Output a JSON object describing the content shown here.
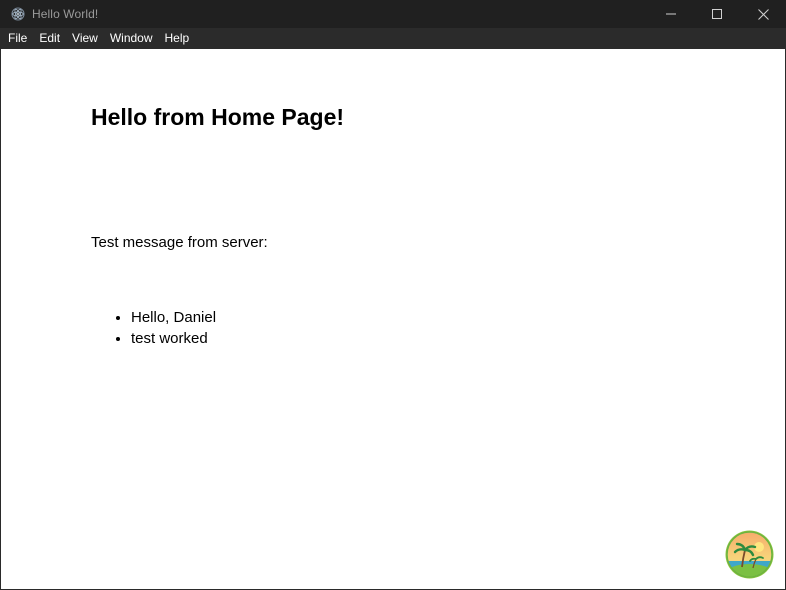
{
  "window": {
    "title": "Hello World!"
  },
  "menu": {
    "items": [
      {
        "label": "File"
      },
      {
        "label": "Edit"
      },
      {
        "label": "View"
      },
      {
        "label": "Window"
      },
      {
        "label": "Help"
      }
    ]
  },
  "main": {
    "title": "Hello from Home Page!",
    "message_label": "Test message from server:",
    "messages": [
      "Hello, Daniel",
      "test worked"
    ]
  },
  "icons": {
    "app": "electron-icon",
    "minimize": "minimize-icon",
    "maximize": "maximize-icon",
    "close": "close-icon",
    "avatar": "palm-island-avatar-icon"
  },
  "colors": {
    "titlebar_bg": "#202020",
    "menubar_bg": "#2b2b2b",
    "content_bg": "#ffffff"
  }
}
